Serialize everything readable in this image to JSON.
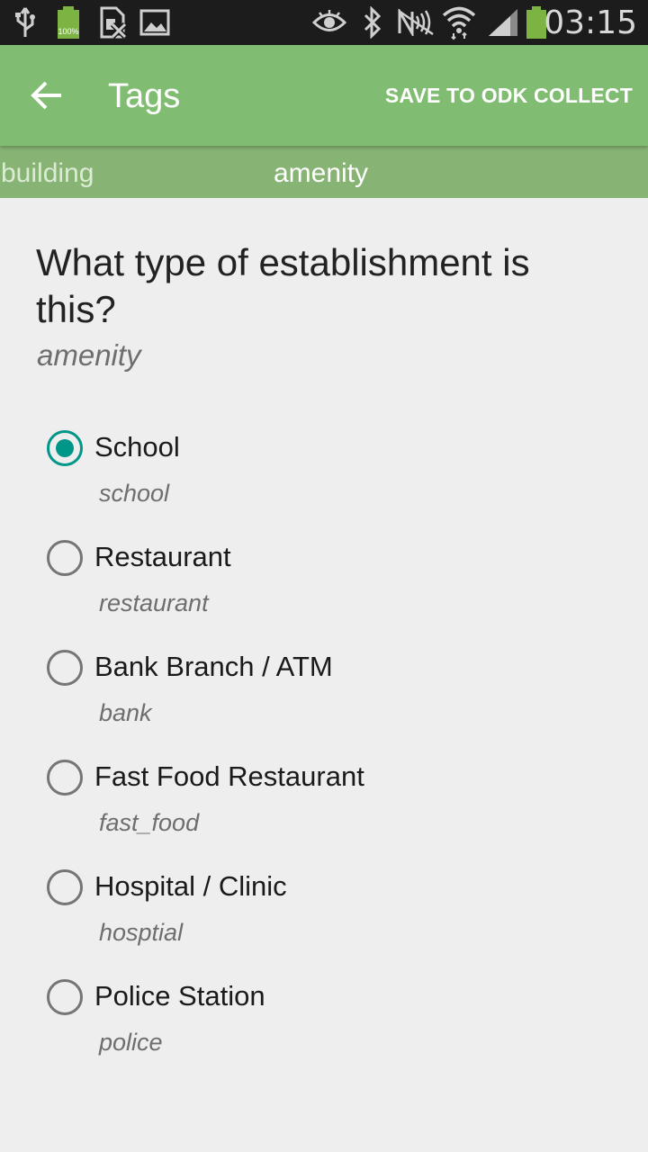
{
  "status_bar": {
    "time": "03:15",
    "battery_label": "100%",
    "icons": [
      "usb-icon",
      "battery-full-icon",
      "no-sim-icon",
      "image-icon",
      "eye-icon",
      "bluetooth-icon",
      "nfc-icon",
      "wifi-icon",
      "signal-icon",
      "battery-icon"
    ]
  },
  "app_bar": {
    "back_icon": "arrow-back-icon",
    "title": "Tags",
    "action": "SAVE TO ODK COLLECT",
    "color": "#80bd72"
  },
  "tabs": [
    {
      "label": "building",
      "selected": false
    },
    {
      "label": "amenity",
      "selected": true
    }
  ],
  "question": {
    "text": "What type of establishment is this?",
    "key": "amenity"
  },
  "options": [
    {
      "label": "School",
      "value": "school",
      "selected": true
    },
    {
      "label": "Restaurant",
      "value": "restaurant",
      "selected": false
    },
    {
      "label": "Bank Branch / ATM",
      "value": "bank",
      "selected": false
    },
    {
      "label": "Fast Food Restaurant",
      "value": "fast_food",
      "selected": false
    },
    {
      "label": "Hospital / Clinic",
      "value": "hosptial",
      "selected": false
    },
    {
      "label": "Police Station",
      "value": "police",
      "selected": false
    }
  ],
  "colors": {
    "accent": "#009688",
    "tab_strip": "#87b474",
    "background": "#eeeeee"
  }
}
